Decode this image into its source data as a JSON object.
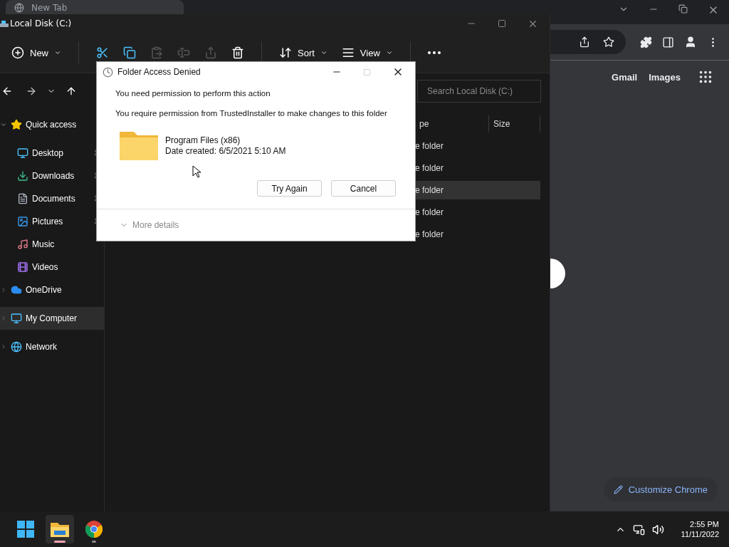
{
  "browser": {
    "tab": {
      "title": "New Tab"
    },
    "links": [
      {
        "label": "Gmail"
      },
      {
        "label": "Images"
      }
    ],
    "customize_button": "Customize Chrome"
  },
  "explorer": {
    "title": "Local Disk (C:)",
    "toolbar": [
      {
        "kind": "new",
        "label": "New",
        "disabled": false
      },
      {
        "kind": "cut",
        "disabled": false
      },
      {
        "kind": "copy",
        "disabled": false
      },
      {
        "kind": "paste",
        "disabled": true
      },
      {
        "kind": "rename",
        "disabled": true
      },
      {
        "kind": "share",
        "disabled": true
      },
      {
        "kind": "delete",
        "disabled": false
      },
      {
        "kind": "sort",
        "label": "Sort",
        "disabled": false
      },
      {
        "kind": "view",
        "label": "View",
        "disabled": false
      },
      {
        "kind": "more",
        "disabled": false
      }
    ],
    "search": {
      "placeholder": "Search Local Disk (C:)"
    },
    "sidebar": {
      "items": [
        {
          "label": "Quick access",
          "kind": "star",
          "expanded": true,
          "selected": false,
          "children": [
            {
              "label": "Desktop",
              "kind": "desktop",
              "pinned": true,
              "selected": false
            },
            {
              "label": "Downloads",
              "kind": "downloads",
              "pinned": true,
              "selected": false
            },
            {
              "label": "Documents",
              "kind": "documents",
              "pinned": true,
              "selected": false
            },
            {
              "label": "Pictures",
              "kind": "pictures",
              "pinned": true,
              "selected": false
            },
            {
              "label": "Music",
              "kind": "music",
              "pinned": false,
              "selected": false
            },
            {
              "label": "Videos",
              "kind": "videos",
              "pinned": false,
              "selected": false
            }
          ]
        },
        {
          "label": "OneDrive",
          "kind": "onedrive",
          "expanded": false,
          "selected": false
        },
        {
          "label": "My Computer",
          "kind": "computer",
          "expanded": false,
          "selected": true
        },
        {
          "label": "Network",
          "kind": "network",
          "expanded": false,
          "selected": false
        }
      ]
    },
    "columns": [
      {
        "label": "pe"
      },
      {
        "label": "Size"
      }
    ],
    "rows": [
      {
        "type": "e folder",
        "selected": false
      },
      {
        "type": "e folder",
        "selected": false
      },
      {
        "type": "e folder",
        "selected": true
      },
      {
        "type": "e folder",
        "selected": false
      },
      {
        "type": "e folder",
        "selected": false
      }
    ]
  },
  "dialog": {
    "title": "Folder Access Denied",
    "message": "You need permission to perform this action",
    "detail": "You require permission from TrustedInstaller to make changes to this folder",
    "item": {
      "name": "Program Files (x86)",
      "date": "Date created: 6/5/2021 5:10 AM"
    },
    "buttons": [
      {
        "label": "Try Again"
      },
      {
        "label": "Cancel"
      }
    ],
    "more_details": {
      "label": "More details",
      "expanded": false
    }
  },
  "taskbar": {
    "apps": [
      {
        "kind": "start",
        "active": false
      },
      {
        "kind": "explorer",
        "active": true
      },
      {
        "kind": "chrome",
        "active": false
      }
    ],
    "time": "2:55 PM",
    "date": "11/11/2022"
  }
}
